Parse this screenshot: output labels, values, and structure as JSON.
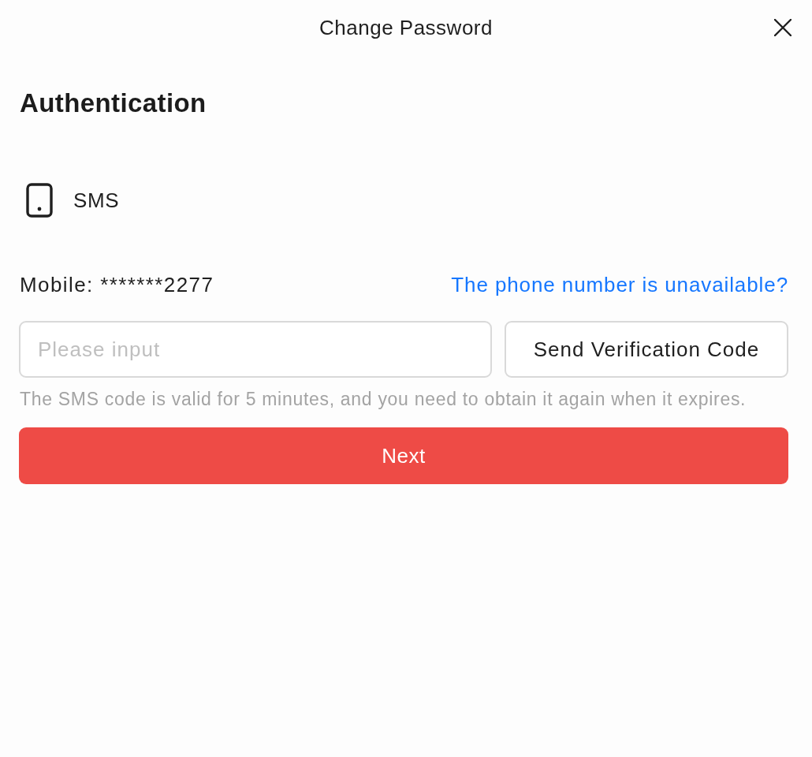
{
  "dialog": {
    "title": "Change Password"
  },
  "section": {
    "heading": "Authentication"
  },
  "method": {
    "label": "SMS"
  },
  "mobile": {
    "label": "Mobile: *******2277",
    "link": "The phone number is unavailable?"
  },
  "code_field": {
    "placeholder": "Please input"
  },
  "send_button": "Send Verification Code",
  "hint": "The SMS code is valid for 5 minutes, and you need to obtain it again when it expires.",
  "next_button": "Next"
}
